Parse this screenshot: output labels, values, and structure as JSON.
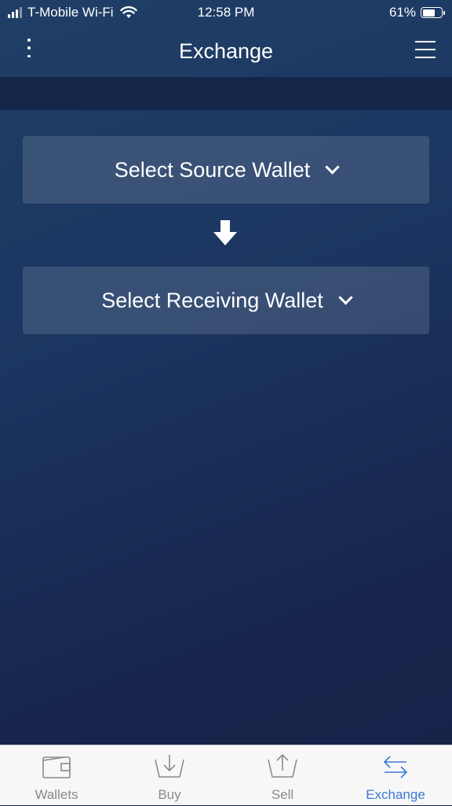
{
  "status_bar": {
    "carrier": "T-Mobile Wi-Fi",
    "time": "12:58 PM",
    "battery": "61%",
    "battery_level": 0.61,
    "wifi_icon": "wifi-icon",
    "signal_icon": "signal-bars-icon"
  },
  "nav": {
    "title": "Exchange",
    "left_icon": "kebab-menu-icon",
    "right_icon": "hamburger-menu-icon"
  },
  "exchange": {
    "source_label": "Select Source Wallet",
    "receiving_label": "Select Receiving Wallet",
    "arrow_icon": "arrow-down-icon",
    "chevron_icon": "chevron-down-icon"
  },
  "tabs": [
    {
      "label": "Wallets",
      "icon": "wallet-icon",
      "active": false
    },
    {
      "label": "Buy",
      "icon": "buy-basket-icon",
      "active": false
    },
    {
      "label": "Sell",
      "icon": "sell-basket-icon",
      "active": false
    },
    {
      "label": "Exchange",
      "icon": "exchange-arrows-icon",
      "active": true
    }
  ],
  "colors": {
    "background_top": "#1f3f66",
    "background_bottom": "#152248",
    "selector_fill": "rgba(255,255,255,0.13)",
    "tab_active": "#3b78d6",
    "tab_inactive": "#8a8a8a"
  }
}
